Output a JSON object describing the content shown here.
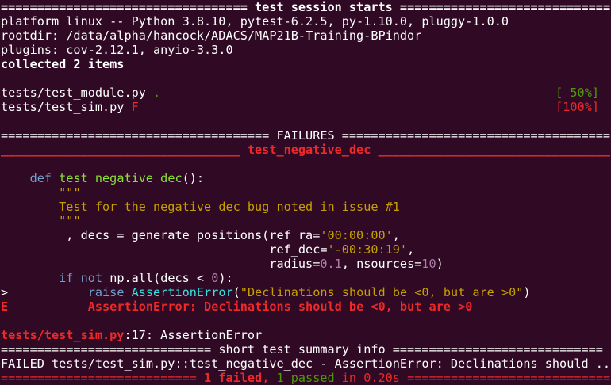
{
  "header": {
    "left_rule": "==================================",
    "title": " test session starts ",
    "right_rule": "=================================="
  },
  "session": {
    "platform": "platform linux -- Python 3.8.10, pytest-6.2.5, py-1.10.0, pluggy-1.0.0",
    "rootdir": "rootdir: /data/alpha/hancock/ADACS/MAP21B-Training-BPindor",
    "plugins": "plugins: cov-2.12.1, anyio-3.3.0",
    "collected": "collected 2 items"
  },
  "results": [
    {
      "file": "tests/test_module.py ",
      "mark": ".",
      "progress": "[ 50%]",
      "status": "pass"
    },
    {
      "file": "tests/test_sim.py ",
      "mark": "F",
      "progress": "[100%]",
      "status": "fail"
    }
  ],
  "failures_header": {
    "left_rule": "=====================================",
    "title": " FAILURES ",
    "right_rule": "====================================="
  },
  "failure_title": {
    "left_rule": "_________________________________",
    "name": " test_negative_dec ",
    "right_rule": "________________________________"
  },
  "code": {
    "def_kw": "def",
    "func_name": "test_negative_dec",
    "def_rest": "():",
    "doc_open": "\"\"\"",
    "doc_text": "Test for the negative dec bug noted in issue #1",
    "doc_close": "\"\"\"",
    "l1a": "_, decs = generate_positions(ref_ra=",
    "l1s": "'00:00:00'",
    "l1b": ",",
    "l2a": "ref_dec=",
    "l2s": "'-00:30:19'",
    "l2b": ",",
    "l3a": "radius=",
    "l3n1": "0.1",
    "l3b": ", nsources=",
    "l3n2": "10",
    "l3c": ")",
    "if_kw": "if",
    "not_kw": "not",
    "if_rest1": " np.all(decs < ",
    "if_num": "0",
    "if_rest2": "):",
    "arrow": ">",
    "raise_kw": "raise",
    "exc_cls": "AssertionError",
    "raise_open": "(",
    "raise_msg": "\"Declinations should be <0, but are >0\"",
    "raise_close": ")",
    "e_marker": "E",
    "e_msg": "AssertionError: Declinations should be <0, but are >0"
  },
  "location": {
    "path": "tests/test_sim.py",
    "rest": ":17: AssertionError"
  },
  "summary_header": {
    "left_rule": "=============================",
    "title": " short test summary info ",
    "right_rule": "============================="
  },
  "summary_line": "FAILED tests/test_sim.py::test_negative_dec - AssertionError: Declinations should ...",
  "final": {
    "left_rule": "=========================== ",
    "failed": "1 failed",
    "sep": ", ",
    "passed": "1 passed",
    "in": " in 0.20s",
    "right_rule": " ============================"
  }
}
